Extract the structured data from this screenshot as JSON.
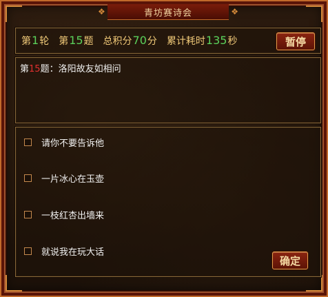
{
  "title": "青坊赛诗会",
  "stats": {
    "round_prefix": "第",
    "round_value": "1",
    "round_suffix": "轮",
    "question_prefix": "第",
    "question_value": "15",
    "question_suffix": "题",
    "score_label": "总积分",
    "score_value": "70",
    "score_unit": "分",
    "time_label": "累计耗时",
    "time_value": "135",
    "time_unit": "秒"
  },
  "buttons": {
    "pause": "暂停",
    "confirm": "确定"
  },
  "question": {
    "prefix": "第",
    "number": "15",
    "suffix": "题：",
    "text": "洛阳故友如相问"
  },
  "options": [
    {
      "label": "请你不要告诉他"
    },
    {
      "label": "一片冰心在玉壶"
    },
    {
      "label": "一枝红杏出墙来"
    },
    {
      "label": "就说我在玩大话"
    }
  ],
  "colors": {
    "accent_green": "#5bd15b",
    "question_number": "#e03030",
    "gold_text": "#f0c978",
    "button_red": "#8a2410"
  }
}
